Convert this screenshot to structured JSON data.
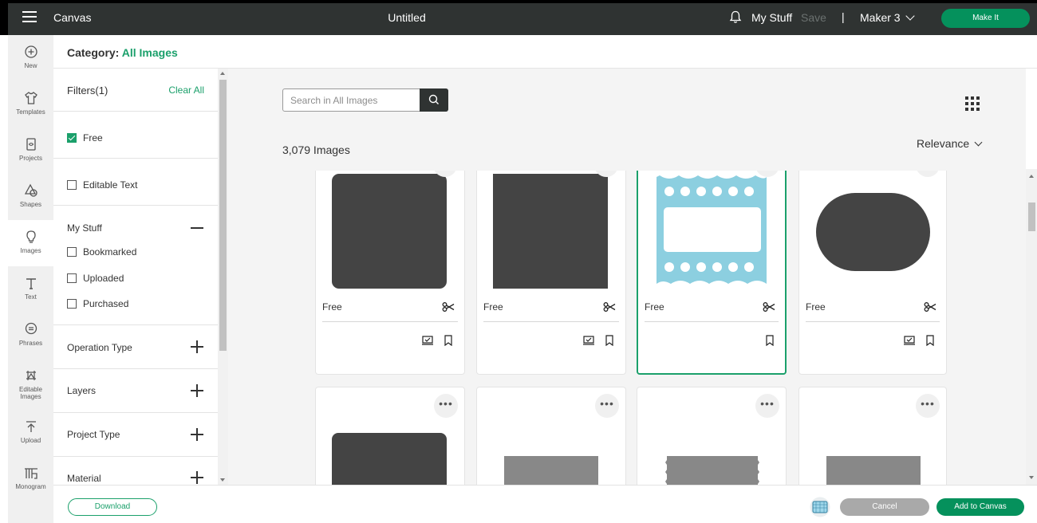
{
  "topbar": {
    "app_title": "Canvas",
    "doc_title": "Untitled",
    "my_stuff": "My Stuff",
    "save": "Save",
    "separator": "|",
    "machine": "Maker 3",
    "make_it": "Make It"
  },
  "rail": {
    "items": [
      {
        "label": "New",
        "icon": "plus-circle-icon"
      },
      {
        "label": "Templates",
        "icon": "shirt-icon"
      },
      {
        "label": "Projects",
        "icon": "project-icon"
      },
      {
        "label": "Shapes",
        "icon": "shapes-icon"
      },
      {
        "label": "Images",
        "icon": "lightbulb-icon"
      },
      {
        "label": "Text",
        "icon": "text-icon"
      },
      {
        "label": "Phrases",
        "icon": "speech-bubble-icon"
      },
      {
        "label": "Editable Images",
        "icon": "editable-image-icon"
      },
      {
        "label": "Upload",
        "icon": "upload-icon"
      },
      {
        "label": "Monogram",
        "icon": "monogram-icon"
      }
    ],
    "active": "Images"
  },
  "category": {
    "label": "Category:",
    "value": "All Images"
  },
  "filters": {
    "title": "Filters(1)",
    "clear_all": "Clear All",
    "free": "Free",
    "editable_text": "Editable Text",
    "my_stuff_title": "My Stuff",
    "bookmarked": "Bookmarked",
    "uploaded": "Uploaded",
    "purchased": "Purchased",
    "sections": [
      "Operation Type",
      "Layers",
      "Project Type",
      "Material"
    ]
  },
  "search": {
    "placeholder": "Search in All Images"
  },
  "results": {
    "count": "3,079 Images",
    "sort": "Relevance",
    "cards": [
      {
        "price": "Free",
        "shape": "rounded-rectangle",
        "selected": false
      },
      {
        "price": "Free",
        "shape": "square",
        "selected": false
      },
      {
        "price": "Free",
        "shape": "ticket-frame",
        "selected": true
      },
      {
        "price": "Free",
        "shape": "oval",
        "selected": false
      }
    ],
    "more_label": "•••"
  },
  "footer": {
    "download": "Download",
    "cancel": "Cancel",
    "add_to_canvas": "Add to Canvas"
  },
  "colors": {
    "accent": "#1ba06b",
    "topbar": "#2f3332",
    "shape": "#444444",
    "ticket": "#8ccfe0"
  }
}
